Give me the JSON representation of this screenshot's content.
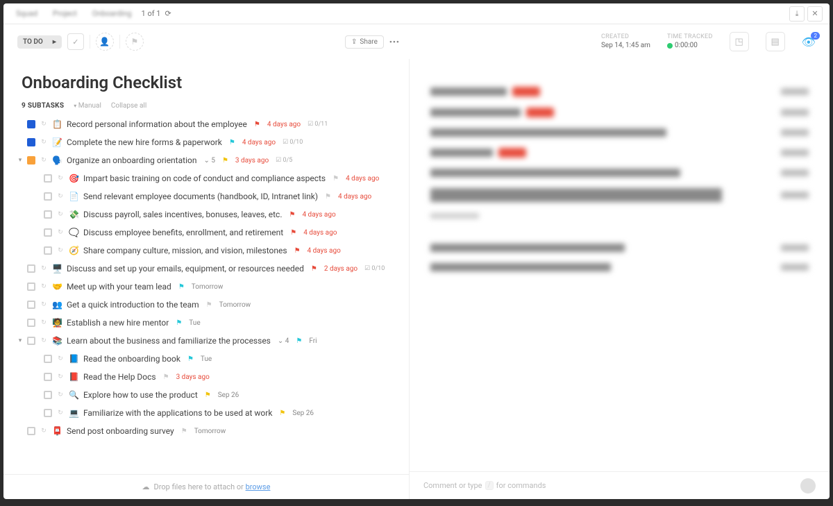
{
  "breadcrumbs": [
    "Squad",
    "Project",
    "Onboarding"
  ],
  "pager": "1 of 1",
  "status": "TO DO",
  "shareLabel": "Share",
  "created": {
    "label": "CREATED",
    "value": "Sep 14, 1:45 am"
  },
  "tracked": {
    "label": "TIME TRACKED",
    "value": "0:00:00"
  },
  "watchers": "2",
  "title": "Onboarding Checklist",
  "subtasksCount": "9 SUBTASKS",
  "manual": "Manual",
  "collapse": "Collapse all",
  "dropText": "Drop files here to attach or ",
  "browse": "browse",
  "commentPlaceholder": "Comment or type ",
  "commentSuffix": " for commands",
  "tasks": [
    {
      "indent": 0,
      "toggle": "",
      "color": "blue",
      "emoji": "📋",
      "name": "Record personal information about the employee",
      "flag": "red",
      "due": "4 days ago",
      "dueClass": "red",
      "progress": "0/11"
    },
    {
      "indent": 0,
      "toggle": "",
      "color": "blue",
      "emoji": "📝",
      "name": "Complete the new hire forms & paperwork",
      "flag": "cyan",
      "due": "4 days ago",
      "dueClass": "red",
      "progress": "0/10"
    },
    {
      "indent": 0,
      "toggle": "▾",
      "color": "orange",
      "emoji": "🗣️",
      "name": "Organize an onboarding orientation",
      "subcount": "5",
      "flag": "yellow",
      "due": "3 days ago",
      "dueClass": "red",
      "progress": "0/5"
    },
    {
      "indent": 1,
      "toggle": "",
      "color": "grey",
      "emoji": "🎯",
      "name": "Impart basic training on code of conduct and compliance aspects",
      "flag": "grey",
      "due": "4 days ago",
      "dueClass": "red"
    },
    {
      "indent": 1,
      "toggle": "",
      "color": "grey",
      "emoji": "📄",
      "name": "Send relevant employee documents (handbook, ID, Intranet link)",
      "flag": "grey",
      "due": "4 days ago",
      "dueClass": "red"
    },
    {
      "indent": 1,
      "toggle": "",
      "color": "grey",
      "emoji": "💸",
      "name": "Discuss payroll, sales incentives, bonuses, leaves, etc.",
      "flag": "red",
      "due": "4 days ago",
      "dueClass": "red"
    },
    {
      "indent": 1,
      "toggle": "",
      "color": "grey",
      "emoji": "🗨️",
      "name": "Discuss employee benefits, enrollment, and retirement",
      "flag": "red",
      "due": "4 days ago",
      "dueClass": "red"
    },
    {
      "indent": 1,
      "toggle": "",
      "color": "grey",
      "emoji": "🧭",
      "name": "Share company culture, mission, and vision, milestones",
      "flag": "red",
      "due": "4 days ago",
      "dueClass": "red"
    },
    {
      "indent": 0,
      "toggle": "",
      "color": "grey",
      "emoji": "🖥️",
      "name": "Discuss and set up your emails, equipment, or resources needed",
      "flag": "red",
      "due": "2 days ago",
      "dueClass": "red",
      "progress": "0/10"
    },
    {
      "indent": 0,
      "toggle": "",
      "color": "grey",
      "emoji": "🤝",
      "name": "Meet up with your team lead",
      "flag": "cyan",
      "due": "Tomorrow",
      "dueClass": "grey"
    },
    {
      "indent": 0,
      "toggle": "",
      "color": "grey",
      "emoji": "👥",
      "name": "Get a quick introduction to the team",
      "flag": "grey",
      "due": "Tomorrow",
      "dueClass": "grey"
    },
    {
      "indent": 0,
      "toggle": "",
      "color": "grey",
      "emoji": "🧑‍🏫",
      "name": "Establish a new hire mentor",
      "flag": "cyan",
      "due": "Tue",
      "dueClass": "grey"
    },
    {
      "indent": 0,
      "toggle": "▾",
      "color": "grey",
      "emoji": "📚",
      "name": "Learn about the business and familiarize the processes",
      "subcount": "4",
      "flag": "cyan",
      "due": "Fri",
      "dueClass": "grey"
    },
    {
      "indent": 1,
      "toggle": "",
      "color": "grey",
      "emoji": "📘",
      "name": "Read the onboarding book",
      "flag": "cyan",
      "due": "Tue",
      "dueClass": "grey"
    },
    {
      "indent": 1,
      "toggle": "",
      "color": "grey",
      "emoji": "📕",
      "name": "Read the Help Docs",
      "flag": "grey",
      "due": "3 days ago",
      "dueClass": "red"
    },
    {
      "indent": 1,
      "toggle": "",
      "color": "grey",
      "emoji": "🔍",
      "name": "Explore how to use the product",
      "flag": "yellow",
      "due": "Sep 26",
      "dueClass": "grey"
    },
    {
      "indent": 1,
      "toggle": "",
      "color": "grey",
      "emoji": "💻",
      "name": "Familiarize with the applications to be used at work",
      "flag": "yellow",
      "due": "Sep 26",
      "dueClass": "grey"
    },
    {
      "indent": 0,
      "toggle": "",
      "color": "grey",
      "emoji": "📮",
      "name": "Send post onboarding survey",
      "flag": "grey",
      "due": "Tomorrow",
      "dueClass": "grey"
    }
  ]
}
